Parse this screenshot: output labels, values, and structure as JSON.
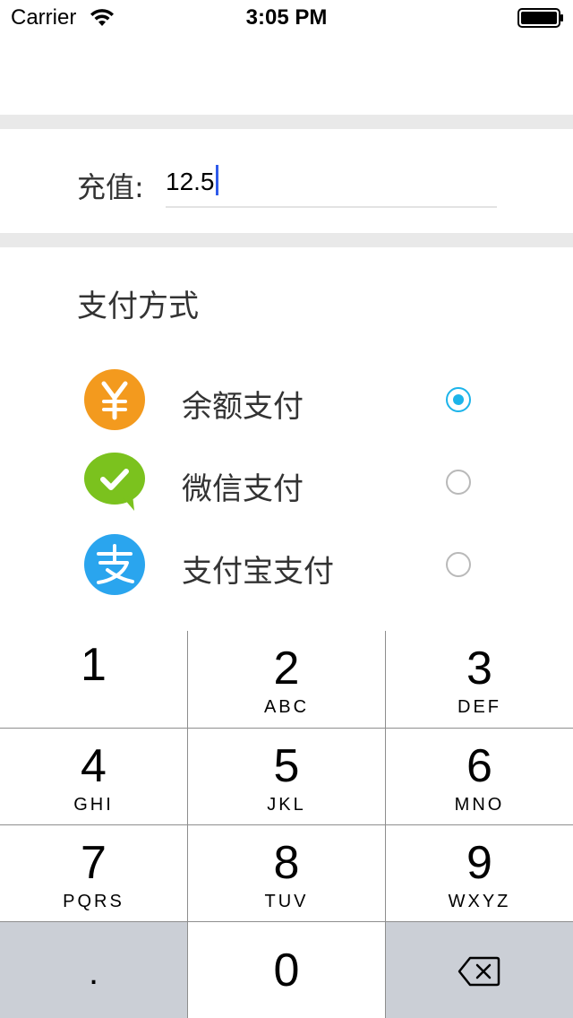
{
  "status_bar": {
    "carrier": "Carrier",
    "time": "3:05 PM"
  },
  "recharge": {
    "label": "充值:",
    "value": "12.5"
  },
  "payment": {
    "title": "支付方式",
    "options": [
      {
        "label": "余额支付",
        "icon": "yuan-icon",
        "icon_color": "#f39a1e",
        "selected": true
      },
      {
        "label": "微信支付",
        "icon": "wechat-icon",
        "icon_color": "#7bc21e",
        "selected": false
      },
      {
        "label": "支付宝支付",
        "icon": "alipay-icon",
        "icon_color": "#2aa5ee",
        "selected": false
      }
    ]
  },
  "keypad": {
    "keys": [
      {
        "digit": "1",
        "letters": ""
      },
      {
        "digit": "2",
        "letters": "ABC"
      },
      {
        "digit": "3",
        "letters": "DEF"
      },
      {
        "digit": "4",
        "letters": "GHI"
      },
      {
        "digit": "5",
        "letters": "JKL"
      },
      {
        "digit": "6",
        "letters": "MNO"
      },
      {
        "digit": "7",
        "letters": "PQRS"
      },
      {
        "digit": "8",
        "letters": "TUV"
      },
      {
        "digit": "9",
        "letters": "WXYZ"
      },
      {
        "digit": ".",
        "letters": ""
      },
      {
        "digit": "0",
        "letters": ""
      }
    ]
  },
  "colors": {
    "accent": "#1cb4ea",
    "caret": "#2f5bea",
    "separator": "#e9e9e9",
    "keypad_gray": "#cbcfd6"
  }
}
